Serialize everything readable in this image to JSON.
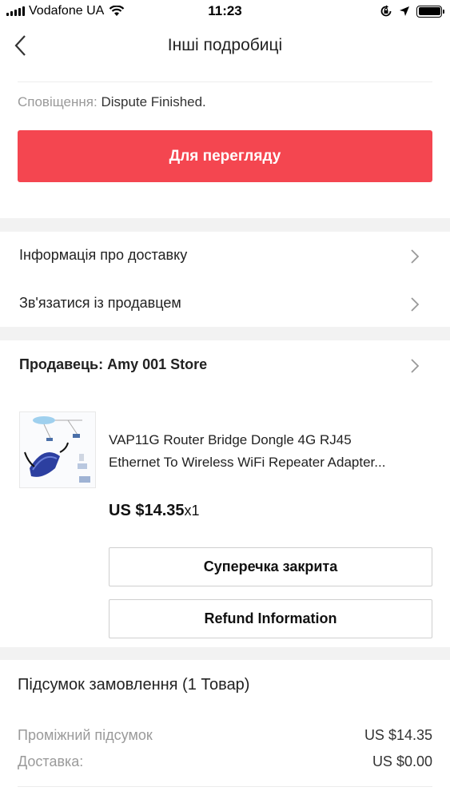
{
  "status_bar": {
    "carrier": "Vodafone UA",
    "time": "11:23"
  },
  "nav": {
    "title": "Інші подробиці"
  },
  "notice": {
    "label": "Сповіщення:",
    "value": "Dispute Finished."
  },
  "primary_button": "Для перегляду",
  "menu": {
    "delivery_info": "Інформація про доставку",
    "contact_seller": "Зв'язатися із продавцем"
  },
  "seller": {
    "label": "Продавець:",
    "name": "Amy 001 Store"
  },
  "product": {
    "title_line1": "VAP11G Router Bridge Dongle 4G RJ45",
    "title_line2": "Ethernet To Wireless WiFi Repeater Adapter...",
    "price": "US $14.35",
    "qty": "x1"
  },
  "actions": {
    "dispute_closed": "Суперечка закрита",
    "refund_info": "Refund Information"
  },
  "summary": {
    "title": "Підсумок замовлення (1 Товар)",
    "subtotal_label": "Проміжний підсумок",
    "subtotal_value": "US $14.35",
    "shipping_label": "Доставка:",
    "shipping_value": "US $0.00"
  },
  "colors": {
    "accent": "#f44650",
    "section_gap": "#f2f2f2"
  }
}
